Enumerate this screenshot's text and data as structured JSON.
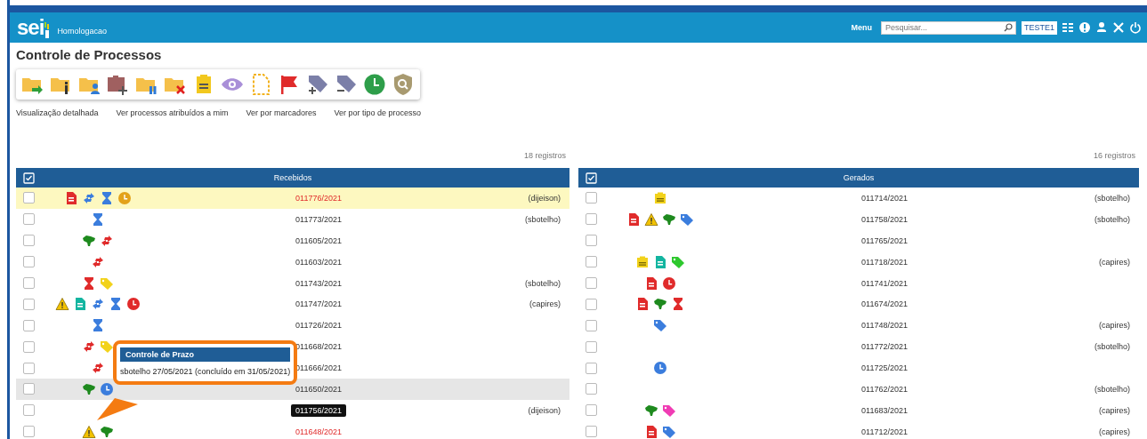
{
  "header": {
    "logo": "sei",
    "environment": "Homologacao",
    "menu_label": "Menu",
    "search": {
      "placeholder": "Pesquisar..."
    },
    "unit": "TESTE1"
  },
  "page_title": "Controle de Processos",
  "links": [
    "Visualização detalhada",
    "Ver processos atribuídos a mim",
    "Ver por marcadores",
    "Ver por tipo de processo"
  ],
  "panels": [
    {
      "count": "18 registros",
      "title": "Recebidos",
      "rows": [
        {
          "checked": false,
          "selected": true,
          "hovered": false,
          "markers": [
            {
              "kind": "document",
              "color": "#e02b2b"
            },
            {
              "kind": "transfer",
              "color": "#3b7ddd"
            },
            {
              "kind": "hourglass",
              "color": "#3b7ddd"
            },
            {
              "kind": "clock",
              "color": "#e3a21a"
            }
          ],
          "number": "011776/2021",
          "alert": true,
          "focused": false,
          "user": "(dijeison)"
        },
        {
          "checked": false,
          "selected": false,
          "hovered": false,
          "markers": [
            {
              "kind": "hourglass",
              "color": "#3b7ddd"
            }
          ],
          "number": "011773/2021",
          "alert": false,
          "focused": false,
          "user": "(sbotelho)"
        },
        {
          "checked": false,
          "selected": false,
          "hovered": false,
          "markers": [
            {
              "kind": "map",
              "color": "#1e8a1e"
            },
            {
              "kind": "transfer",
              "color": "#e02b2b"
            }
          ],
          "number": "011605/2021",
          "alert": false,
          "focused": false
        },
        {
          "checked": false,
          "selected": false,
          "hovered": false,
          "markers": [
            {
              "kind": "transfer",
              "color": "#e02b2b"
            }
          ],
          "number": "011603/2021",
          "alert": false,
          "focused": false
        },
        {
          "checked": false,
          "selected": false,
          "hovered": false,
          "markers": [
            {
              "kind": "hourglass",
              "color": "#e02b2b"
            },
            {
              "kind": "tag",
              "color": "#f2d21b"
            }
          ],
          "number": "011743/2021",
          "alert": false,
          "focused": false,
          "user": "(sbotelho)"
        },
        {
          "checked": false,
          "selected": false,
          "hovered": false,
          "markers": [
            {
              "kind": "warning",
              "color": "#f2c200"
            },
            {
              "kind": "document",
              "color": "#13b5a0"
            },
            {
              "kind": "transfer",
              "color": "#3b7ddd"
            },
            {
              "kind": "hourglass",
              "color": "#3b7ddd"
            },
            {
              "kind": "clock",
              "color": "#e02b2b"
            }
          ],
          "number": "011747/2021",
          "alert": false,
          "focused": false,
          "user": "(capires)"
        },
        {
          "checked": false,
          "selected": false,
          "hovered": false,
          "markers": [
            {
              "kind": "hourglass",
              "color": "#3b7ddd"
            }
          ],
          "number": "011726/2021",
          "alert": false,
          "focused": false
        },
        {
          "checked": false,
          "selected": false,
          "hovered": false,
          "markers": [
            {
              "kind": "transfer",
              "color": "#e02b2b"
            },
            {
              "kind": "tag",
              "color": "#f2d21b"
            }
          ],
          "number": "011668/2021",
          "alert": false,
          "focused": false
        },
        {
          "checked": false,
          "selected": false,
          "hovered": false,
          "markers": [
            {
              "kind": "transfer",
              "color": "#e02b2b"
            }
          ],
          "number": "011666/2021",
          "alert": false,
          "focused": false,
          "tooltip": {
            "title": "Controle de Prazo",
            "text": "sbotelho 27/05/2021 (concluído em 31/05/2021)"
          }
        },
        {
          "checked": false,
          "selected": false,
          "hovered": true,
          "markers": [
            {
              "kind": "map",
              "color": "#1e8a1e"
            },
            {
              "kind": "clock",
              "color": "#3b7ddd"
            }
          ],
          "number": "011650/2021",
          "alert": false,
          "focused": false
        },
        {
          "checked": false,
          "selected": false,
          "hovered": false,
          "markers": [],
          "number": "011756/2021",
          "alert": false,
          "focused": true,
          "user": "(dijeison)"
        },
        {
          "checked": false,
          "selected": false,
          "hovered": false,
          "markers": [
            {
              "kind": "warning",
              "color": "#f2c200"
            },
            {
              "kind": "map",
              "color": "#1e8a1e"
            }
          ],
          "number": "011648/2021",
          "alert": true,
          "focused": false
        }
      ]
    },
    {
      "count": "16 registros",
      "title": "Gerados",
      "rows": [
        {
          "checked": false,
          "selected": false,
          "hovered": false,
          "markers": [
            {
              "kind": "note",
              "color": "#f2d21b"
            }
          ],
          "number": "011714/2021",
          "alert": false,
          "focused": false,
          "user": "(sbotelho)"
        },
        {
          "checked": false,
          "selected": false,
          "hovered": false,
          "markers": [
            {
              "kind": "document",
              "color": "#e02b2b"
            },
            {
              "kind": "warning",
              "color": "#f2c200"
            },
            {
              "kind": "map",
              "color": "#1e8a1e"
            },
            {
              "kind": "tag",
              "color": "#3b7ddd"
            }
          ],
          "number": "011758/2021",
          "alert": false,
          "focused": false,
          "user": "(sbotelho)"
        },
        {
          "checked": false,
          "selected": false,
          "hovered": false,
          "markers": [],
          "number": "011765/2021",
          "alert": false,
          "focused": false
        },
        {
          "checked": false,
          "selected": false,
          "hovered": false,
          "markers": [
            {
              "kind": "note",
              "color": "#f2d21b"
            },
            {
              "kind": "document",
              "color": "#13b5a0"
            },
            {
              "kind": "tag",
              "color": "#2ec82e"
            }
          ],
          "number": "011718/2021",
          "alert": false,
          "focused": false,
          "user": "(capires)"
        },
        {
          "checked": false,
          "selected": false,
          "hovered": false,
          "markers": [
            {
              "kind": "document",
              "color": "#e02b2b"
            },
            {
              "kind": "clock",
              "color": "#e02b2b"
            }
          ],
          "number": "011741/2021",
          "alert": false,
          "focused": false
        },
        {
          "checked": false,
          "selected": false,
          "hovered": false,
          "markers": [
            {
              "kind": "document",
              "color": "#e02b2b"
            },
            {
              "kind": "map",
              "color": "#1e8a1e"
            },
            {
              "kind": "hourglass",
              "color": "#e02b2b"
            }
          ],
          "number": "011674/2021",
          "alert": false,
          "focused": false
        },
        {
          "checked": false,
          "selected": false,
          "hovered": false,
          "markers": [
            {
              "kind": "tag",
              "color": "#3b7ddd"
            }
          ],
          "number": "011748/2021",
          "alert": false,
          "focused": false,
          "user": "(capires)"
        },
        {
          "checked": false,
          "selected": false,
          "hovered": false,
          "markers": [],
          "number": "011772/2021",
          "alert": false,
          "focused": false,
          "user": "(sbotelho)"
        },
        {
          "checked": false,
          "selected": false,
          "hovered": false,
          "markers": [
            {
              "kind": "clock",
              "color": "#3b7ddd"
            }
          ],
          "number": "011725/2021",
          "alert": false,
          "focused": false
        },
        {
          "checked": false,
          "selected": false,
          "hovered": false,
          "markers": [],
          "number": "011762/2021",
          "alert": false,
          "focused": false,
          "user": "(sbotelho)"
        },
        {
          "checked": false,
          "selected": false,
          "hovered": false,
          "markers": [
            {
              "kind": "map",
              "color": "#1e8a1e"
            },
            {
              "kind": "tag",
              "color": "#f03cb4"
            }
          ],
          "number": "011683/2021",
          "alert": false,
          "focused": false,
          "user": "(capires)"
        },
        {
          "checked": false,
          "selected": false,
          "hovered": false,
          "markers": [
            {
              "kind": "document",
              "color": "#e02b2b"
            },
            {
              "kind": "tag",
              "color": "#3b7ddd"
            }
          ],
          "number": "011712/2021",
          "alert": false,
          "focused": false,
          "user": "(capires)"
        }
      ]
    }
  ]
}
